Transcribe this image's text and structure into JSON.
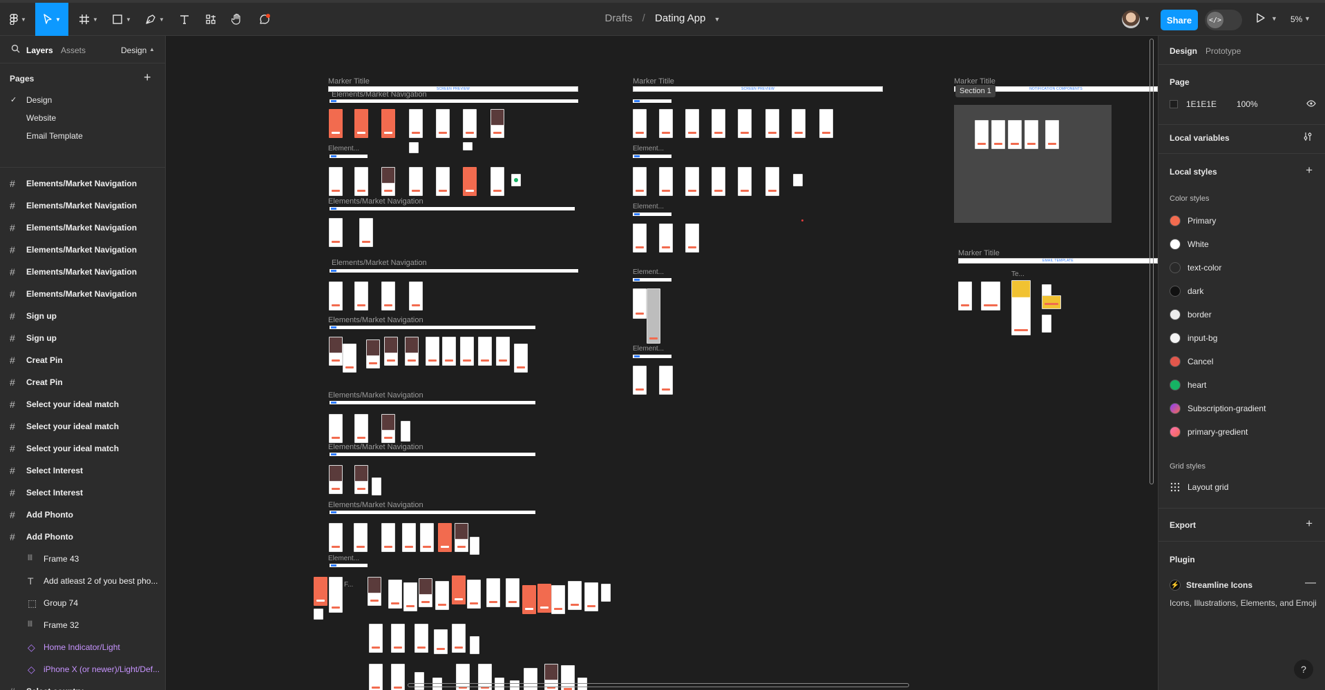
{
  "toolbar": {
    "breadcrumb_root": "Drafts",
    "breadcrumb_sep": "/",
    "file_name": "Dating App",
    "share_label": "Share",
    "devmode_label": "</>",
    "zoom_label": "5%"
  },
  "left_panel": {
    "tabs": {
      "layers": "Layers",
      "assets": "Assets",
      "page_menu": "Design"
    },
    "pages_title": "Pages",
    "pages": [
      {
        "label": "Design",
        "selected": true
      },
      {
        "label": "Website",
        "selected": false
      },
      {
        "label": "Email Template",
        "selected": false
      }
    ],
    "layers": [
      {
        "label": "Elements/Market Navigation",
        "icon": "frame-icon"
      },
      {
        "label": "Elements/Market Navigation",
        "icon": "frame-icon"
      },
      {
        "label": "Elements/Market Navigation",
        "icon": "frame-icon"
      },
      {
        "label": "Elements/Market Navigation",
        "icon": "frame-icon"
      },
      {
        "label": "Elements/Market Navigation",
        "icon": "frame-icon"
      },
      {
        "label": "Elements/Market Navigation",
        "icon": "frame-icon"
      },
      {
        "label": "Sign up",
        "icon": "frame-icon"
      },
      {
        "label": "Sign up",
        "icon": "frame-icon"
      },
      {
        "label": "Creat Pin",
        "icon": "frame-icon"
      },
      {
        "label": "Creat Pin",
        "icon": "frame-icon"
      },
      {
        "label": "Select your ideal match",
        "icon": "frame-icon"
      },
      {
        "label": "Select your ideal match",
        "icon": "frame-icon"
      },
      {
        "label": "Select your ideal match",
        "icon": "frame-icon"
      },
      {
        "label": "Select Interest",
        "icon": "frame-icon"
      },
      {
        "label": "Select Interest",
        "icon": "frame-icon"
      },
      {
        "label": "Add Phonto",
        "icon": "frame-icon"
      },
      {
        "label": "Add Phonto",
        "icon": "frame-icon"
      },
      {
        "label": "Frame 43",
        "icon": "auto-layout-icon",
        "child": true
      },
      {
        "label": "Add atleast 2 of you best pho...",
        "icon": "text-icon",
        "child": true
      },
      {
        "label": "Group 74",
        "icon": "group-icon",
        "child": true
      },
      {
        "label": "Frame 32",
        "icon": "auto-layout-icon",
        "child": true
      },
      {
        "label": "Home Indicator/Light",
        "icon": "component-instance-icon",
        "child": true,
        "component": true
      },
      {
        "label": "iPhone X (or newer)/Light/Def...",
        "icon": "component-instance-icon",
        "child": true,
        "component": true
      },
      {
        "label": "Select country",
        "icon": "frame-icon"
      }
    ]
  },
  "right_panel": {
    "tabs": {
      "design": "Design",
      "prototype": "Prototype"
    },
    "page_section": "Page",
    "bg_hex": "1E1E1E",
    "bg_opacity": "100%",
    "local_variables": "Local variables",
    "local_styles": "Local styles",
    "color_styles_title": "Color styles",
    "color_styles": [
      {
        "name": "Primary",
        "color": "#f26b4f"
      },
      {
        "name": "White",
        "color": "#ffffff"
      },
      {
        "name": "text-color",
        "color": "#2a2a2a"
      },
      {
        "name": "dark",
        "color": "#111111"
      },
      {
        "name": "border",
        "color": "#ececec"
      },
      {
        "name": "input-bg",
        "color": "#f5f5f5"
      },
      {
        "name": "Cancel",
        "color": "#e2574c"
      },
      {
        "name": "heart",
        "color": "#16b364"
      },
      {
        "name": "Subscription-gradient",
        "color": "linear-gradient(135deg,#8a3ffc,#f26b4f)"
      },
      {
        "name": "primary-gredient",
        "color": "linear-gradient(135deg,#ff6fb1,#f26b4f)"
      }
    ],
    "grid_styles_title": "Grid styles",
    "grid_style": "Layout grid",
    "export": "Export",
    "plugin_title": "Plugin",
    "plugin_name": "Streamline Icons",
    "plugin_desc": "Icons, Illustrations, Elements, and Emoji",
    "help_label": "?"
  },
  "canvas": {
    "marker_title": "Marker Titile",
    "elements_nav": "Elements/Market Navigation",
    "element_short": "Element...",
    "screen_preview": "SCREEN PREVIEW",
    "notification_components": "NOTIFICATION COMPONENTS",
    "email_template": "EMAIL TEMPLATE",
    "section_1": "Section 1",
    "te_short": "Te...",
    "f_short": "F..."
  },
  "colors": {
    "accent": "#0d99ff",
    "canvas_bg": "#1e1e1e",
    "panel_bg": "#2c2c2c",
    "primary": "#f26b4f",
    "component": "#c794ff"
  }
}
